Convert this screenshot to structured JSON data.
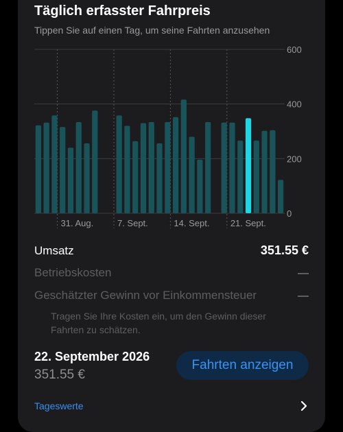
{
  "header": {
    "title": "Täglich erfasster Fahrpreis",
    "subtitle": "Tippen Sie auf einen Tag, um seine Fahrten anzusehen"
  },
  "chart_data": {
    "type": "bar",
    "ylim": [
      0,
      600
    ],
    "y_ticks": [
      "600",
      "400",
      "200",
      "0"
    ],
    "x_tick_labels": [
      "31. Aug.",
      "7. Sept.",
      "14. Sept.",
      "21. Sept."
    ],
    "values": [
      322,
      332,
      358,
      316,
      240,
      334,
      256,
      376,
      null,
      null,
      358,
      320,
      264,
      330,
      334,
      256,
      334,
      352,
      416,
      280,
      196,
      334,
      null,
      332,
      332,
      266,
      348,
      266,
      302,
      304,
      122
    ],
    "selected_index": 26,
    "colors": {
      "bar": "#19545a",
      "selected": "#1fd6e4",
      "grid": "#3c3c40",
      "dashed": "#5a5a5e",
      "label": "#9a9a9e"
    }
  },
  "summary": {
    "revenue_label": "Umsatz",
    "revenue_value": "351.55 €",
    "operating_costs_label": "Betriebskosten",
    "profit_label": "Geschätzter Gewinn vor Einkommensteuer",
    "note": "Tragen Sie Ihre Kosten ein, um den Gewinn dieser Fahrten zu schätzen."
  },
  "selection": {
    "date": "22. September 2026",
    "amount": "351.55 €",
    "button_label": "Fahrten anzeigen"
  },
  "footer": {
    "link_label": "Tageswerte",
    "chevron_icon": "chevron-right-icon"
  }
}
